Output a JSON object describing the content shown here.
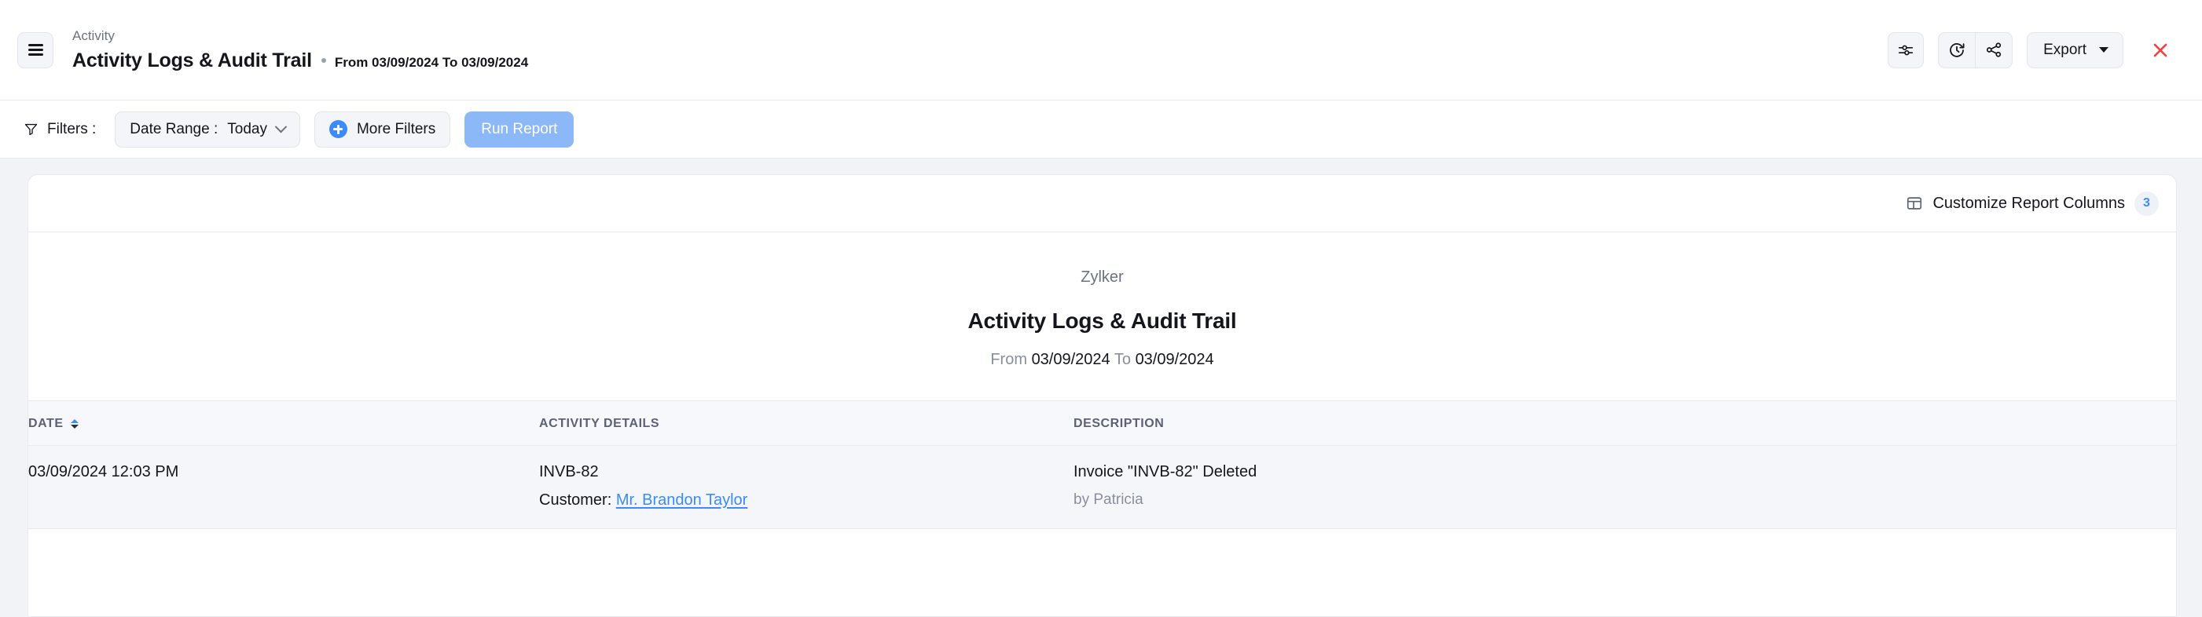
{
  "header": {
    "breadcrumb": "Activity",
    "page_title": "Activity Logs & Audit Trail",
    "date_range_text": "From 03/09/2024 To 03/09/2024",
    "menu_icon": "hamburger-menu-icon",
    "actions": {
      "settings_icon": "sliders-settings-icon",
      "schedule_icon": "clock-refresh-schedule-icon",
      "share_icon": "share-nodes-icon",
      "export_label": "Export",
      "close_icon": "close-x-icon"
    }
  },
  "filters": {
    "label": "Filters :",
    "filter_icon": "funnel-filter-icon",
    "date_range": {
      "label": "Date Range :",
      "value": "Today",
      "chevron_icon": "chevron-down-icon"
    },
    "more_filters_label": "More Filters",
    "more_filters_icon": "plus-circle-icon",
    "run_report_label": "Run Report"
  },
  "report": {
    "customize": {
      "label": "Customize Report Columns",
      "icon": "table-columns-icon",
      "count": "3"
    },
    "org_name": "Zylker",
    "title": "Activity Logs & Audit Trail",
    "range_from_label": "From",
    "range_from_value": "03/09/2024",
    "range_to_label": "To",
    "range_to_value": "03/09/2024",
    "columns": [
      {
        "key": "date",
        "label": "DATE",
        "sortable": true,
        "sort_direction": "asc"
      },
      {
        "key": "activity",
        "label": "ACTIVITY DETAILS",
        "sortable": false
      },
      {
        "key": "description",
        "label": "DESCRIPTION",
        "sortable": false
      }
    ],
    "rows": [
      {
        "date": "03/09/2024 12:03 PM",
        "activity_ref": "INVB-82",
        "activity_customer_label": "Customer:",
        "activity_customer_name": "Mr. Brandon Taylor",
        "description": "Invoice \"INVB-82\" Deleted",
        "description_by": "by Patricia"
      }
    ]
  },
  "colors": {
    "accent_blue": "#3a8bfc",
    "run_button_blue": "#8cb8f8",
    "close_red": "#ef4444",
    "page_bg": "#f2f3f7",
    "row_bg": "#f5f6fa"
  }
}
